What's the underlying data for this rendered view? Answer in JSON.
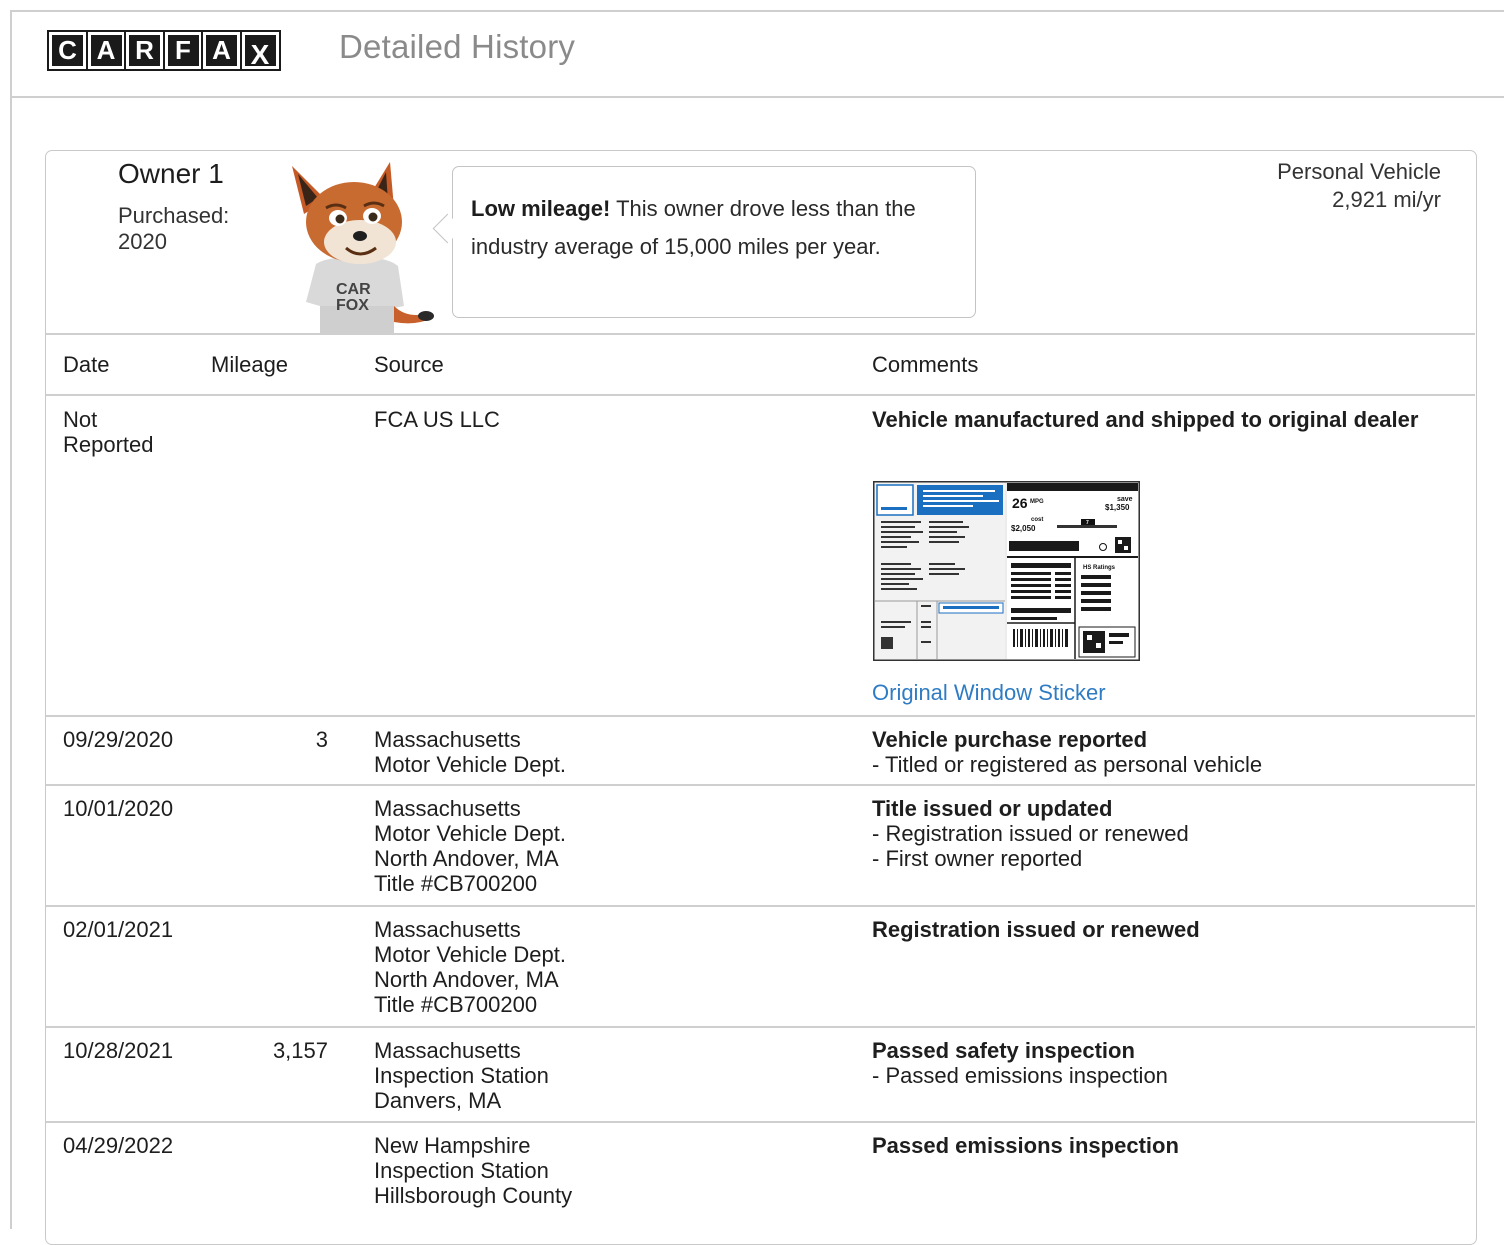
{
  "header": {
    "logo_letters": [
      "C",
      "A",
      "R",
      "F",
      "A",
      "X"
    ],
    "title": "Detailed History"
  },
  "owner": {
    "title": "Owner 1",
    "purchased_label": "Purchased:",
    "purchased_year": "2020",
    "bubble_bold": "Low mileage!",
    "bubble_text": " This owner drove less than the industry average of 15,000 miles per year.",
    "vehicle_type": "Personal Vehicle",
    "annual_mileage": "2,921 mi/yr",
    "fox_shirt_line1": "CAR",
    "fox_shirt_line2": "FOX"
  },
  "table": {
    "headers": [
      "Date",
      "Mileage",
      "Source",
      "Comments"
    ],
    "rows": [
      {
        "date": [
          "Not",
          "Reported"
        ],
        "mileage": "",
        "source": [
          "FCA US LLC"
        ],
        "comment_title": "Vehicle manufactured and shipped to original dealer",
        "comment_lines": [],
        "link": "Original Window Sticker"
      },
      {
        "date": [
          "09/29/2020"
        ],
        "mileage": "3",
        "source": [
          "Massachusetts",
          "Motor Vehicle Dept."
        ],
        "comment_title": "Vehicle purchase reported",
        "comment_lines": [
          "- Titled or registered as personal vehicle"
        ]
      },
      {
        "date": [
          "10/01/2020"
        ],
        "mileage": "",
        "source": [
          "Massachusetts",
          "Motor Vehicle Dept.",
          "North Andover, MA",
          "Title #CB700200"
        ],
        "comment_title": "Title issued or updated",
        "comment_lines": [
          "- Registration issued or renewed",
          "- First owner reported"
        ]
      },
      {
        "date": [
          "02/01/2021"
        ],
        "mileage": "",
        "source": [
          "Massachusetts",
          "Motor Vehicle Dept.",
          "North Andover, MA",
          "Title #CB700200"
        ],
        "comment_title": "Registration issued or renewed",
        "comment_lines": []
      },
      {
        "date": [
          "10/28/2021"
        ],
        "mileage": "3,157",
        "source": [
          "Massachusetts",
          "Inspection Station",
          "Danvers, MA"
        ],
        "comment_title": "Passed safety inspection",
        "comment_lines": [
          "- Passed emissions inspection"
        ]
      },
      {
        "date": [
          "04/29/2022"
        ],
        "mileage": "",
        "source": [
          "New Hampshire",
          "Inspection Station",
          "Hillsborough County"
        ],
        "comment_title": "Passed emissions inspection",
        "comment_lines": []
      }
    ]
  },
  "sticker": {
    "mpg": "26",
    "mpg_unit": "MPG",
    "save_label": "save",
    "save_amount": "$1,350",
    "cost_label": "cost",
    "cost_amount": "$2,050",
    "ratings_label": "HS Ratings",
    "badge_number": "7"
  },
  "colors": {
    "link": "#2f7cc4",
    "border": "#cfcfcf",
    "sticker_blue": "#1b6fc0"
  }
}
